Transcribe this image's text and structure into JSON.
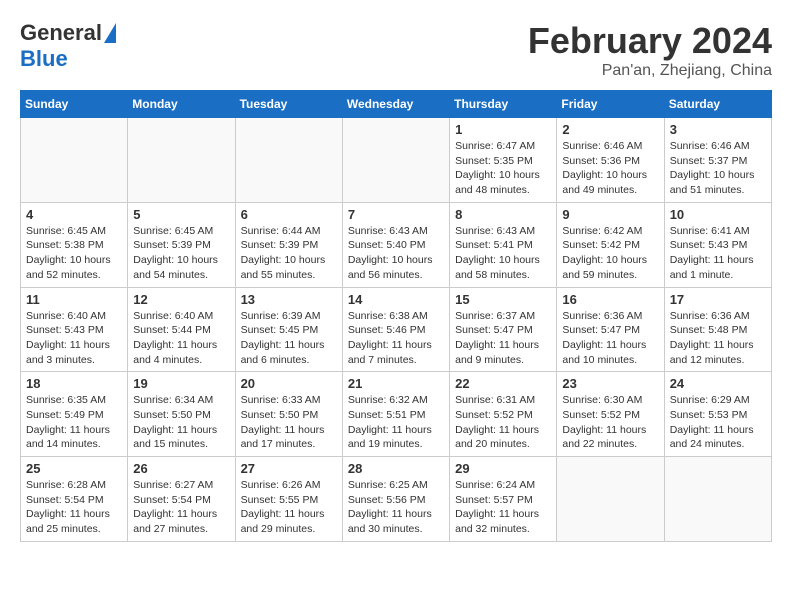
{
  "header": {
    "logo_general": "General",
    "logo_blue": "Blue",
    "title": "February 2024",
    "subtitle": "Pan'an, Zhejiang, China"
  },
  "weekdays": [
    "Sunday",
    "Monday",
    "Tuesday",
    "Wednesday",
    "Thursday",
    "Friday",
    "Saturday"
  ],
  "weeks": [
    [
      {
        "day": "",
        "info": ""
      },
      {
        "day": "",
        "info": ""
      },
      {
        "day": "",
        "info": ""
      },
      {
        "day": "",
        "info": ""
      },
      {
        "day": "1",
        "info": "Sunrise: 6:47 AM\nSunset: 5:35 PM\nDaylight: 10 hours\nand 48 minutes."
      },
      {
        "day": "2",
        "info": "Sunrise: 6:46 AM\nSunset: 5:36 PM\nDaylight: 10 hours\nand 49 minutes."
      },
      {
        "day": "3",
        "info": "Sunrise: 6:46 AM\nSunset: 5:37 PM\nDaylight: 10 hours\nand 51 minutes."
      }
    ],
    [
      {
        "day": "4",
        "info": "Sunrise: 6:45 AM\nSunset: 5:38 PM\nDaylight: 10 hours\nand 52 minutes."
      },
      {
        "day": "5",
        "info": "Sunrise: 6:45 AM\nSunset: 5:39 PM\nDaylight: 10 hours\nand 54 minutes."
      },
      {
        "day": "6",
        "info": "Sunrise: 6:44 AM\nSunset: 5:39 PM\nDaylight: 10 hours\nand 55 minutes."
      },
      {
        "day": "7",
        "info": "Sunrise: 6:43 AM\nSunset: 5:40 PM\nDaylight: 10 hours\nand 56 minutes."
      },
      {
        "day": "8",
        "info": "Sunrise: 6:43 AM\nSunset: 5:41 PM\nDaylight: 10 hours\nand 58 minutes."
      },
      {
        "day": "9",
        "info": "Sunrise: 6:42 AM\nSunset: 5:42 PM\nDaylight: 10 hours\nand 59 minutes."
      },
      {
        "day": "10",
        "info": "Sunrise: 6:41 AM\nSunset: 5:43 PM\nDaylight: 11 hours\nand 1 minute."
      }
    ],
    [
      {
        "day": "11",
        "info": "Sunrise: 6:40 AM\nSunset: 5:43 PM\nDaylight: 11 hours\nand 3 minutes."
      },
      {
        "day": "12",
        "info": "Sunrise: 6:40 AM\nSunset: 5:44 PM\nDaylight: 11 hours\nand 4 minutes."
      },
      {
        "day": "13",
        "info": "Sunrise: 6:39 AM\nSunset: 5:45 PM\nDaylight: 11 hours\nand 6 minutes."
      },
      {
        "day": "14",
        "info": "Sunrise: 6:38 AM\nSunset: 5:46 PM\nDaylight: 11 hours\nand 7 minutes."
      },
      {
        "day": "15",
        "info": "Sunrise: 6:37 AM\nSunset: 5:47 PM\nDaylight: 11 hours\nand 9 minutes."
      },
      {
        "day": "16",
        "info": "Sunrise: 6:36 AM\nSunset: 5:47 PM\nDaylight: 11 hours\nand 10 minutes."
      },
      {
        "day": "17",
        "info": "Sunrise: 6:36 AM\nSunset: 5:48 PM\nDaylight: 11 hours\nand 12 minutes."
      }
    ],
    [
      {
        "day": "18",
        "info": "Sunrise: 6:35 AM\nSunset: 5:49 PM\nDaylight: 11 hours\nand 14 minutes."
      },
      {
        "day": "19",
        "info": "Sunrise: 6:34 AM\nSunset: 5:50 PM\nDaylight: 11 hours\nand 15 minutes."
      },
      {
        "day": "20",
        "info": "Sunrise: 6:33 AM\nSunset: 5:50 PM\nDaylight: 11 hours\nand 17 minutes."
      },
      {
        "day": "21",
        "info": "Sunrise: 6:32 AM\nSunset: 5:51 PM\nDaylight: 11 hours\nand 19 minutes."
      },
      {
        "day": "22",
        "info": "Sunrise: 6:31 AM\nSunset: 5:52 PM\nDaylight: 11 hours\nand 20 minutes."
      },
      {
        "day": "23",
        "info": "Sunrise: 6:30 AM\nSunset: 5:52 PM\nDaylight: 11 hours\nand 22 minutes."
      },
      {
        "day": "24",
        "info": "Sunrise: 6:29 AM\nSunset: 5:53 PM\nDaylight: 11 hours\nand 24 minutes."
      }
    ],
    [
      {
        "day": "25",
        "info": "Sunrise: 6:28 AM\nSunset: 5:54 PM\nDaylight: 11 hours\nand 25 minutes."
      },
      {
        "day": "26",
        "info": "Sunrise: 6:27 AM\nSunset: 5:54 PM\nDaylight: 11 hours\nand 27 minutes."
      },
      {
        "day": "27",
        "info": "Sunrise: 6:26 AM\nSunset: 5:55 PM\nDaylight: 11 hours\nand 29 minutes."
      },
      {
        "day": "28",
        "info": "Sunrise: 6:25 AM\nSunset: 5:56 PM\nDaylight: 11 hours\nand 30 minutes."
      },
      {
        "day": "29",
        "info": "Sunrise: 6:24 AM\nSunset: 5:57 PM\nDaylight: 11 hours\nand 32 minutes."
      },
      {
        "day": "",
        "info": ""
      },
      {
        "day": "",
        "info": ""
      }
    ]
  ]
}
